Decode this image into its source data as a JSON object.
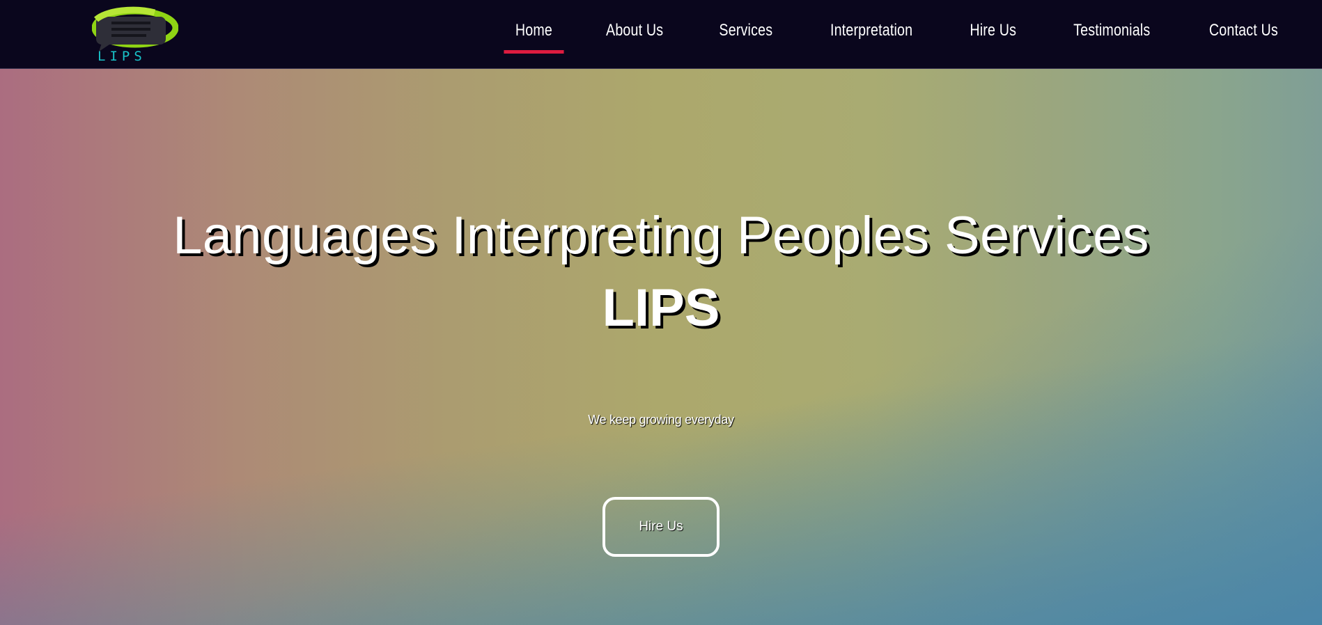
{
  "header": {
    "logo_text": "LIPS",
    "nav": [
      {
        "label": "Home",
        "active": true
      },
      {
        "label": "About Us",
        "active": false
      },
      {
        "label": "Services",
        "active": false
      },
      {
        "label": "Interpretation",
        "active": false
      },
      {
        "label": "Hire Us",
        "active": false
      },
      {
        "label": "Testimonials",
        "active": false
      },
      {
        "label": "Contact Us",
        "active": false
      }
    ]
  },
  "hero": {
    "title": "Languages Interpreting Peoples Services",
    "brand": "LIPS",
    "tagline": "We keep growing everyday",
    "button_label": "Hire Us"
  },
  "colors": {
    "navbar_bg": "#0a061d",
    "active_underline": "#dd1c3f",
    "logo_green": "#8fd414",
    "logo_text": "#19c3c9"
  }
}
